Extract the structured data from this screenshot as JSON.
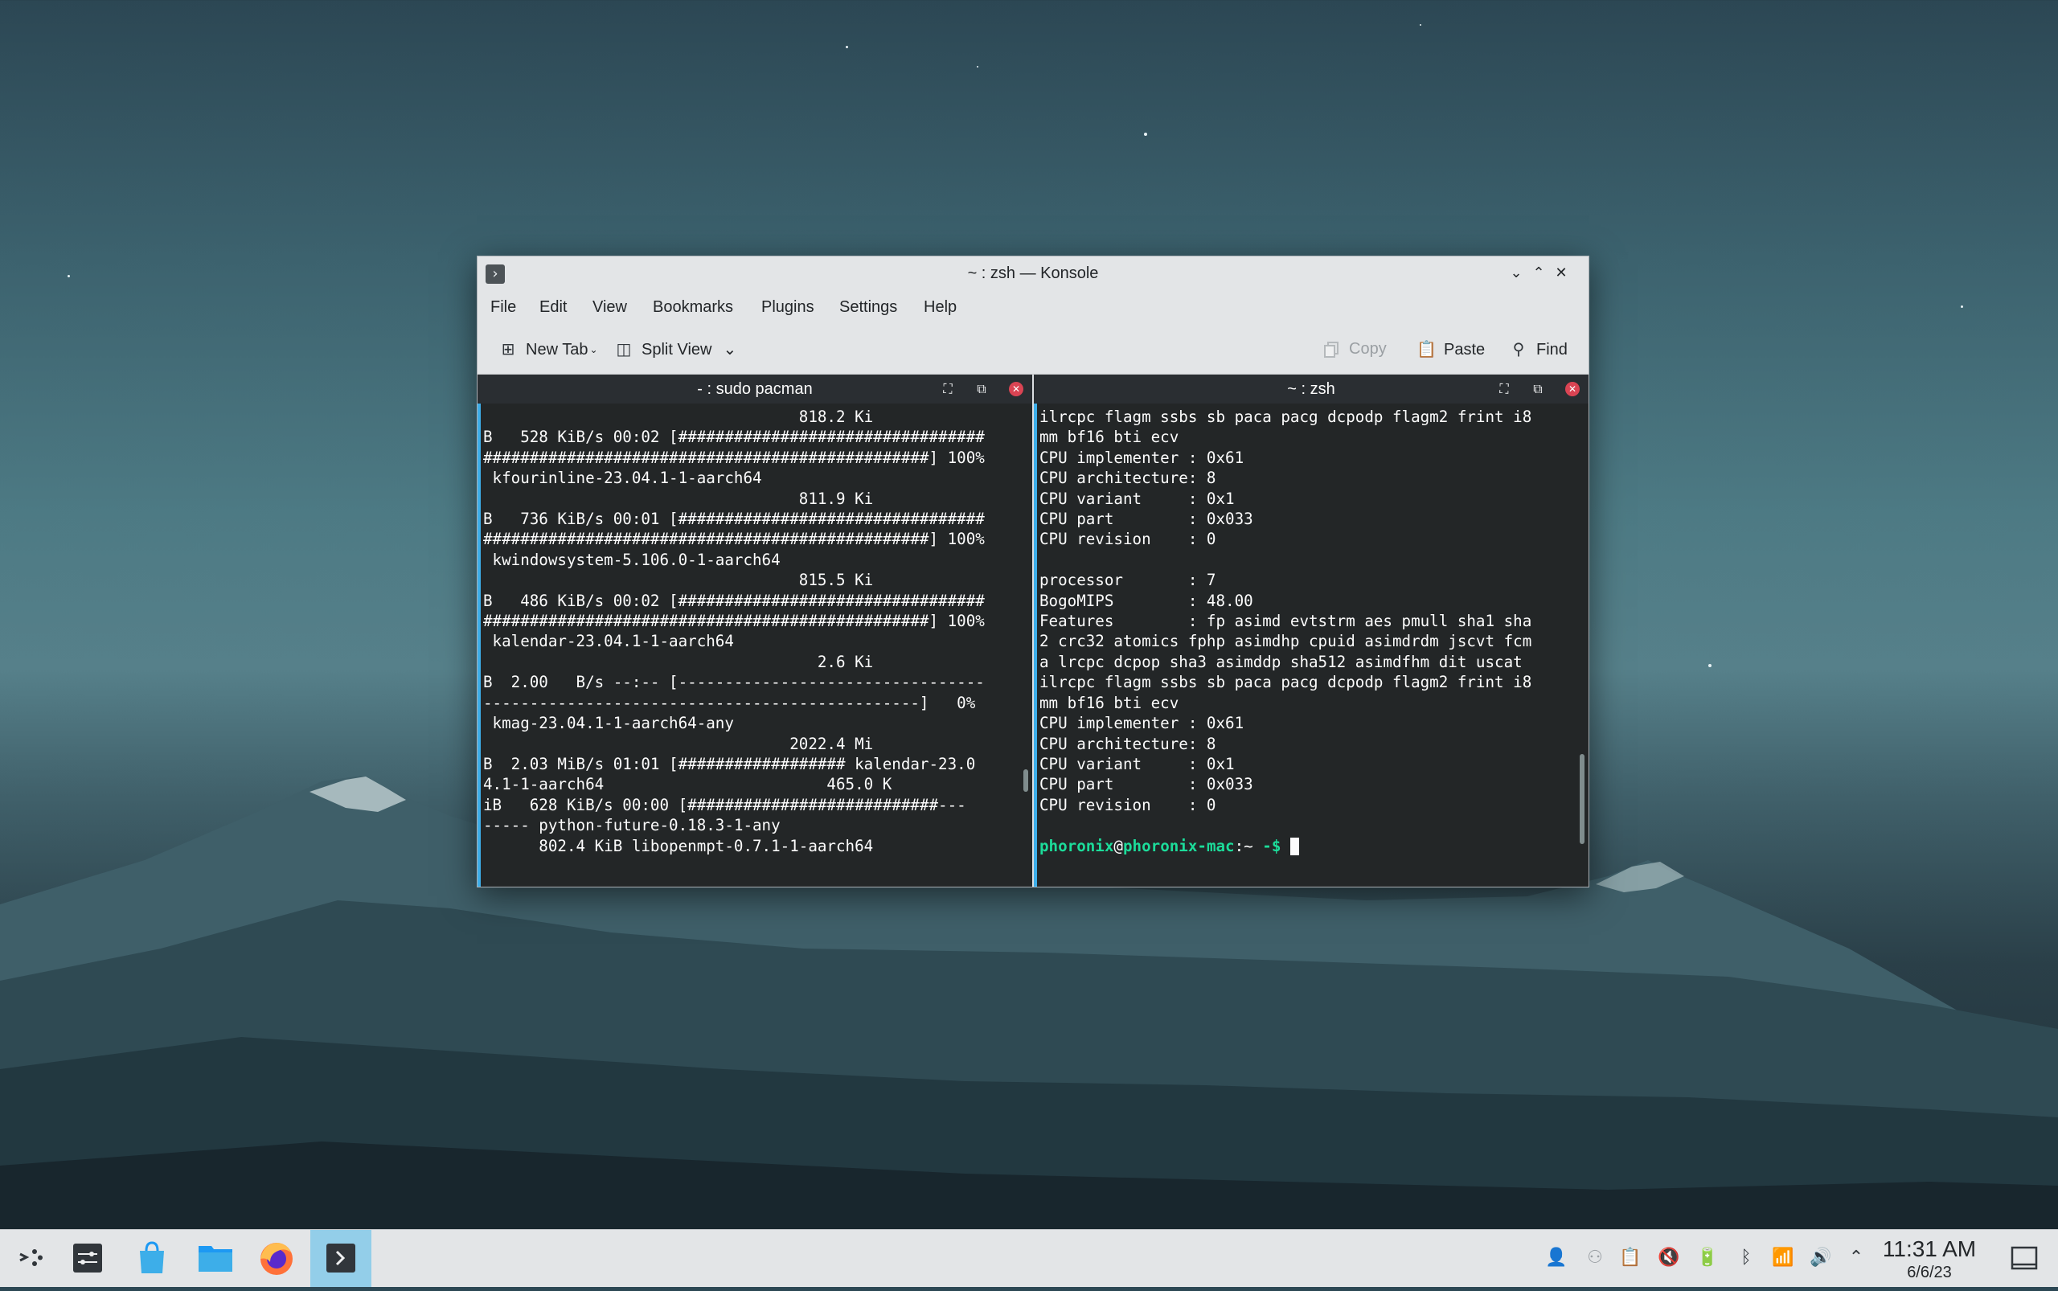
{
  "window": {
    "title": "~ : zsh — Konsole",
    "menu": [
      "File",
      "Edit",
      "View",
      "Bookmarks",
      "Plugins",
      "Settings",
      "Help"
    ],
    "toolbar": {
      "new_tab": "New Tab",
      "split_view": "Split View",
      "copy": "Copy",
      "paste": "Paste",
      "find": "Find"
    }
  },
  "left_pane": {
    "title": "- : sudo pacman",
    "lines": [
      "                                  818.2 Ki",
      "B   528 KiB/s 00:02 [#################################",
      "################################################] 100%",
      " kfourinline-23.04.1-1-aarch64",
      "                                  811.9 Ki",
      "B   736 KiB/s 00:01 [#################################",
      "################################################] 100%",
      " kwindowsystem-5.106.0-1-aarch64",
      "                                  815.5 Ki",
      "B   486 KiB/s 00:02 [#################################",
      "################################################] 100%",
      " kalendar-23.04.1-1-aarch64",
      "                                    2.6 Ki",
      "B  2.00   B/s --:-- [---------------------------------",
      "-----------------------------------------------]   0%",
      " kmag-23.04.1-1-aarch64-any",
      "                                 2022.4 Mi",
      "B  2.03 MiB/s 01:01 [################## kalendar-23.0",
      "4.1-1-aarch64                        465.0 K",
      "iB   628 KiB/s 00:00 [###########################---",
      "----- python-future-0.18.3-1-any",
      "      802.4 KiB libopenmpt-0.7.1-1-aarch64"
    ]
  },
  "right_pane": {
    "title": "~ : zsh",
    "lines": [
      "ilrcpc flagm ssbs sb paca pacg dcpodp flagm2 frint i8",
      "mm bf16 bti ecv",
      "CPU implementer : 0x61",
      "CPU architecture: 8",
      "CPU variant     : 0x1",
      "CPU part        : 0x033",
      "CPU revision    : 0",
      "",
      "processor       : 7",
      "BogoMIPS        : 48.00",
      "Features        : fp asimd evtstrm aes pmull sha1 sha",
      "2 crc32 atomics fphp asimdhp cpuid asimdrdm jscvt fcm",
      "a lrcpc dcpop sha3 asimddp sha512 asimdfhm dit uscat",
      "ilrcpc flagm ssbs sb paca pacg dcpodp flagm2 frint i8",
      "mm bf16 bti ecv",
      "CPU implementer : 0x61",
      "CPU architecture: 8",
      "CPU variant     : 0x1",
      "CPU part        : 0x033",
      "CPU revision    : 0",
      ""
    ],
    "prompt": {
      "user": "phoronix",
      "at": "@",
      "host": "phoronix-mac",
      "path": ":~ ",
      "symbol": "-$"
    }
  },
  "taskbar": {
    "apps": [
      "app-launcher-icon",
      "system-settings-icon",
      "discover-icon",
      "dolphin-icon",
      "firefox-icon",
      "konsole-icon"
    ],
    "clock_time": "11:31 AM",
    "clock_date": "6/6/23"
  },
  "colors": {
    "accent": "#3daee9",
    "prompt": "#1cdc9a",
    "close": "#da4453",
    "terminal_bg": "#232627"
  }
}
